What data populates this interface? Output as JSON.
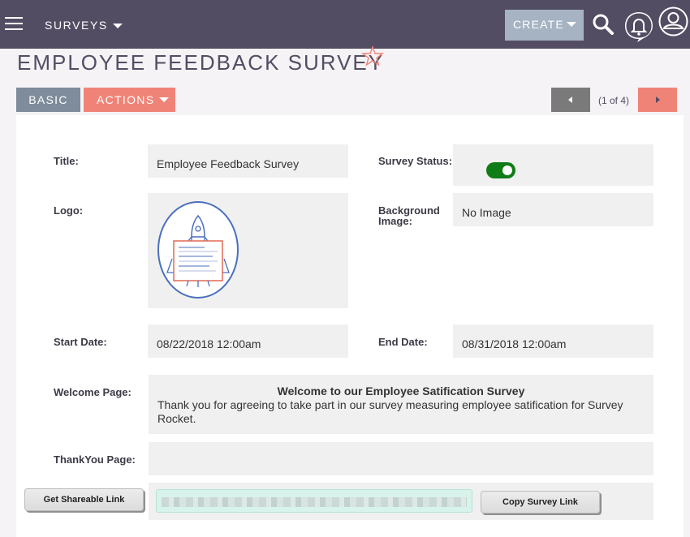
{
  "nav": {
    "module_label": "SURVEYS",
    "create_label": "CREATE",
    "icons": [
      "hamburger-icon",
      "search-icon",
      "notification-bell-icon",
      "user-profile-icon"
    ]
  },
  "page": {
    "title": "EMPLOYEE FEEDBACK SURVEY",
    "favorite_icon": "star-icon"
  },
  "tabs": {
    "basic": "BASIC",
    "actions": "ACTIONS"
  },
  "pagination": {
    "label": "(1 of 4)"
  },
  "fields": {
    "title": {
      "label": "Title:",
      "value": "Employee Feedback Survey"
    },
    "survey_status": {
      "label": "Survey Status:",
      "enabled": true
    },
    "logo": {
      "label": "Logo:",
      "image": "rocket-survey-logo"
    },
    "background_image": {
      "label": "Background Image:",
      "value": "No Image"
    },
    "start_date": {
      "label": "Start Date:",
      "value": "08/22/2018 12:00am"
    },
    "end_date": {
      "label": "End Date:",
      "value": "08/31/2018 12:00am"
    },
    "welcome_page": {
      "label": "Welcome Page:",
      "heading": "Welcome to our Employee Satification Survey",
      "body": "Thank you for agreeing to take part in our survey measuring employee satification for Survey Rocket."
    },
    "thankyou_page": {
      "label": "ThankYou Page:",
      "value": ""
    }
  },
  "share": {
    "get_link_label": "Get Shareable Link",
    "copy_link_label": "Copy Survey Link"
  },
  "colors": {
    "nav_bg": "#534d64",
    "accent": "#f08377",
    "toggle_on": "#0e7c17",
    "logo_blue": "#4a6fbf"
  }
}
